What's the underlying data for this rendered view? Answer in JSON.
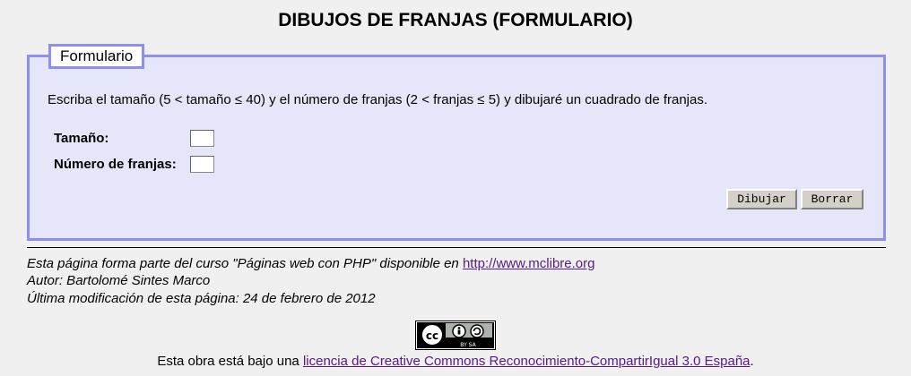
{
  "page": {
    "title": "DIBUJOS DE FRANJAS (FORMULARIO)"
  },
  "form": {
    "legend": "Formulario",
    "instructions": "Escriba el tamaño (5 < tamaño ≤ 40) y el número de franjas (2 < franjas ≤ 5) y dibujaré un cuadrado de franjas.",
    "size_label": "Tamaño:",
    "size_value": "",
    "stripes_label": "Número de franjas:",
    "stripes_value": "",
    "draw_button": "Dibujar",
    "reset_button": "Borrar"
  },
  "footer": {
    "course_prefix": "Esta página forma parte del curso \"Páginas web con PHP\" disponible en ",
    "course_link": "http://www.mclibre.org",
    "author": "Autor: Bartolomé Sintes Marco",
    "modified": "Última modificación de esta página: 24 de febrero de 2012",
    "cc_badge_text": "BY SA",
    "license_prefix": "Esta obra está bajo una ",
    "license_link": "licencia de Creative Commons Reconocimiento-CompartirIgual 3.0 España",
    "license_suffix": "."
  },
  "colors": {
    "background": "#f0f0f0",
    "form_background": "#e6e6fa",
    "form_border": "#8f8fee",
    "link": "#551a8b"
  }
}
